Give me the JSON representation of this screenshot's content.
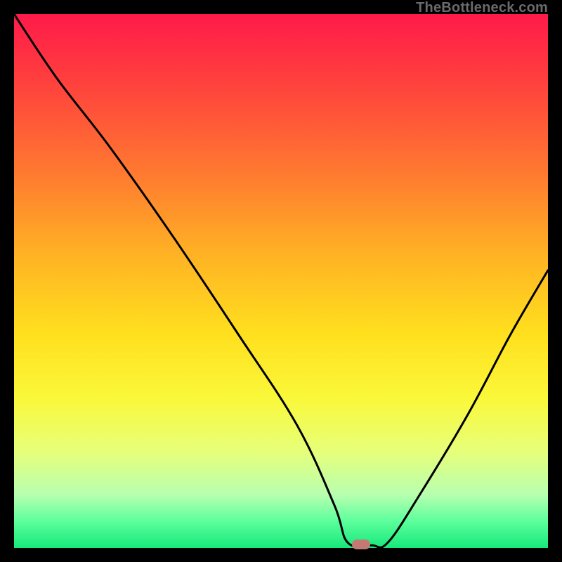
{
  "watermark": "TheBottleneck.com",
  "chart_data": {
    "type": "line",
    "title": "",
    "xlabel": "",
    "ylabel": "",
    "xlim": [
      0,
      100
    ],
    "ylim": [
      0,
      100
    ],
    "grid": false,
    "series": [
      {
        "name": "bottleneck-curve",
        "x": [
          0,
          8,
          18,
          30,
          42,
          53,
          60,
          62.5,
          67,
          70,
          76,
          85,
          93,
          100
        ],
        "y": [
          100,
          88,
          75,
          58,
          40,
          23,
          8,
          1,
          0.5,
          1,
          10,
          25,
          40,
          52
        ]
      }
    ],
    "marker": {
      "x": 65,
      "y": 0.7,
      "color": "#c47a74"
    },
    "gradient_stops": [
      {
        "pct": 0,
        "color": "#ff1a4a"
      },
      {
        "pct": 12,
        "color": "#ff3e3e"
      },
      {
        "pct": 30,
        "color": "#ff7a30"
      },
      {
        "pct": 45,
        "color": "#ffb224"
      },
      {
        "pct": 60,
        "color": "#ffe01e"
      },
      {
        "pct": 72,
        "color": "#faf83a"
      },
      {
        "pct": 82,
        "color": "#e6ff7a"
      },
      {
        "pct": 90,
        "color": "#b8ffb0"
      },
      {
        "pct": 95,
        "color": "#5cff9c"
      },
      {
        "pct": 100,
        "color": "#17e87a"
      }
    ]
  }
}
